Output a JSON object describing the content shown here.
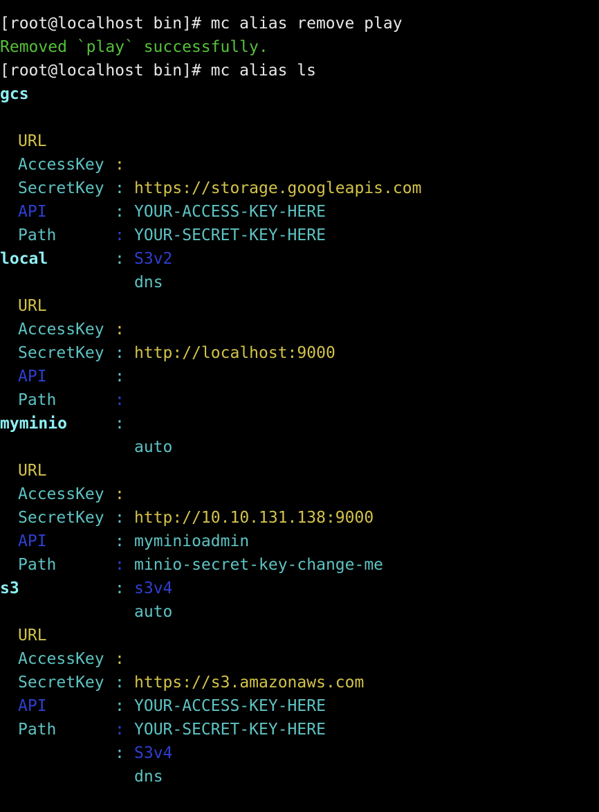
{
  "colors": {
    "background": "#000000",
    "command_text": "#e8e8e8",
    "success_text": "#56c03a",
    "alias_name": "#8ff0f3",
    "url_field": "#d3c34a",
    "key_field": "#5ec3c3",
    "api_field": "#2f3fd0"
  },
  "session": {
    "cmd1": "[root@localhost bin]# mc alias remove play",
    "cmd1_output": "Removed `play` successfully.",
    "cmd2": "[root@localhost bin]# mc alias ls"
  },
  "separator": ":",
  "labels": {
    "url": "URL",
    "access_key": "AccessKey",
    "secret_key": "SecretKey",
    "api": "API",
    "path": "Path"
  },
  "aliases": [
    {
      "name": "gcs",
      "url": "https://storage.googleapis.com",
      "access_key": "YOUR-ACCESS-KEY-HERE",
      "secret_key": "YOUR-SECRET-KEY-HERE",
      "api": "S3v2",
      "path": "dns"
    },
    {
      "name": "local",
      "url": "http://localhost:9000",
      "access_key": "",
      "secret_key": "",
      "api": "",
      "path": "auto"
    },
    {
      "name": "myminio",
      "url": "http://10.10.131.138:9000",
      "access_key": "myminioadmin",
      "secret_key": "minio-secret-key-change-me",
      "api": "s3v4",
      "path": "auto"
    },
    {
      "name": "s3",
      "url": "https://s3.amazonaws.com",
      "access_key": "YOUR-ACCESS-KEY-HERE",
      "secret_key": "YOUR-SECRET-KEY-HERE",
      "api": "S3v4",
      "path": "dns"
    }
  ]
}
